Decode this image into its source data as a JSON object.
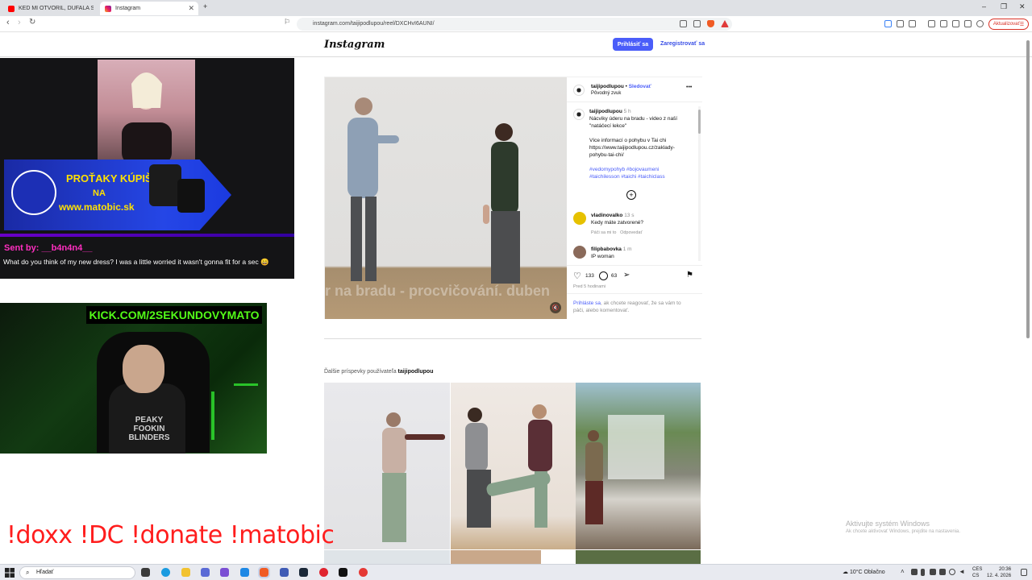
{
  "browser": {
    "tabs": [
      {
        "title": "KEĎ MI OTVORIL, DÚFALA SOM, ŽE...",
        "icon": "youtube-icon",
        "active": false
      },
      {
        "title": "Instagram",
        "icon": "instagram-icon",
        "active": true
      }
    ],
    "new_tab_symbol": "+",
    "url": "instagram.com/taijipodlupou/reel/DXCHvI6AUNI/",
    "update_button": "Aktualizovať",
    "window_controls": {
      "minimize": "–",
      "maximize": "❐",
      "close": "✕"
    }
  },
  "instagram": {
    "logo": "Instagram",
    "login_button": "Prihlásiť sa",
    "register_link": "Zaregistrovať sa",
    "post": {
      "author": "taijipodlupou",
      "separator": "•",
      "follow": "Sledovať",
      "audio": "Pôvodný zvuk",
      "more_icon": "•••",
      "caption_time": "5 h",
      "caption_lines": [
        "Nácviky úderu na bradu - video z naší",
        "\"natáčecí lekce\"",
        "",
        "Více informací o pohybu v Tai chi",
        "https://www.taijipodlupou.cz/zaklady-",
        "pohybu-tai-chi/"
      ],
      "hashtags_line1": "#vedomypohyb #bojovaumeni",
      "hashtags_line2": "#taichilesson #taichi #taichiclass",
      "video_caption": "r na bradu - procvičování. duben",
      "comments": [
        {
          "user": "vladinovalko",
          "time": "13 s",
          "text": "Kedy máte zatvorené?",
          "meta_like": "Páči sa mi to",
          "meta_reply": "Odpovedať"
        },
        {
          "user": "filipbabovka",
          "time": "1 m",
          "text": "IP woman"
        }
      ],
      "likes": "133",
      "comments_count": "63",
      "posted": "Pred 5 hodinami",
      "login_prompt_link": "Prihláste sa",
      "login_prompt_rest": ", ak chcete reagovať, že sa vám to",
      "login_prompt_line2": "páči, alebo komentovať."
    },
    "more_posts_prefix": "Ďalšie príspevky používateľa",
    "more_posts_user": "taijipodlupou"
  },
  "stream": {
    "banner_line1": "PROŤAKY KÚPIŠ",
    "banner_line2": "NA",
    "banner_line3": "www.matobic.sk",
    "sent_by": "Sent by: __b4n4n4__",
    "alert_message": "What do you think of my new dress? I was a little worried it wasn't gonna fit for a sec 😄",
    "kick_label": "KICK.COM/2SEKUNDOVYMATO",
    "shirt_text": "PEAKY FOOKIN BLINDERS",
    "commands": "!doxx  !DC !donate !matobic"
  },
  "windows": {
    "activate_title": "Aktivujte systém Windows",
    "activate_sub": "Ak chcete aktivovať Windows, prejdite na nastavenia.",
    "search_placeholder": "Hľadať",
    "weather": "10°C  Oblačno",
    "lang1": "CES",
    "lang2": "CS",
    "time": "20:36",
    "date": "12. 4. 2026"
  },
  "colors": {
    "accent": "#4a5df9",
    "kick_green": "#53fc18",
    "command_red": "#ff1d1d"
  }
}
